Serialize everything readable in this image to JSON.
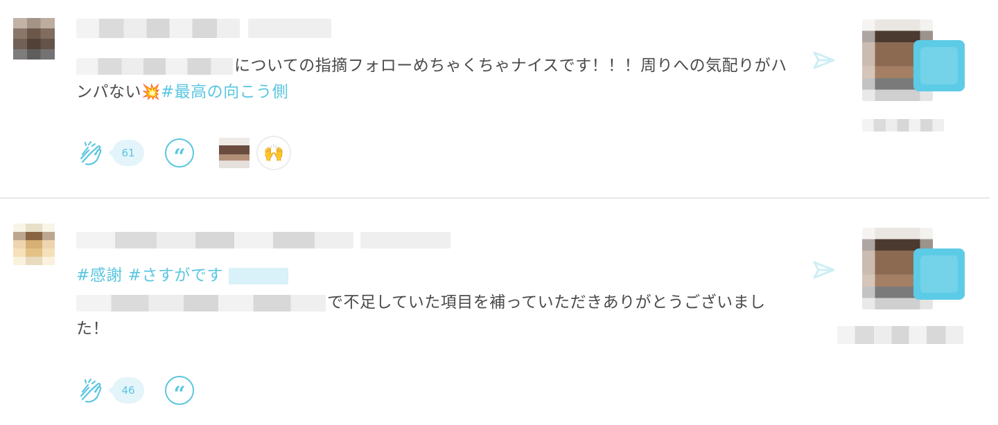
{
  "posts": [
    {
      "message_text": "についての指摘フォローめちゃくちゃナイスです！！！周りへの気配りがハンパない",
      "emoji": "💥",
      "hashtags": "#最高の向こう側",
      "clap_count": "61",
      "reaction_emoji": "🙌",
      "quote_symbol": "“"
    },
    {
      "hashtags": "#感謝 #さすがです",
      "message_text": "で不足していた項目を補っていただきありがとうございました！",
      "clap_count": "46",
      "quote_symbol": "“"
    }
  ],
  "colors": {
    "accent": "#5ac6e0",
    "text": "#4a4a4a",
    "divider": "#e6e6e6",
    "count_bg": "#e3f4fa"
  },
  "icons": [
    "clap-icon",
    "quote-icon",
    "send-arrow-icon"
  ]
}
